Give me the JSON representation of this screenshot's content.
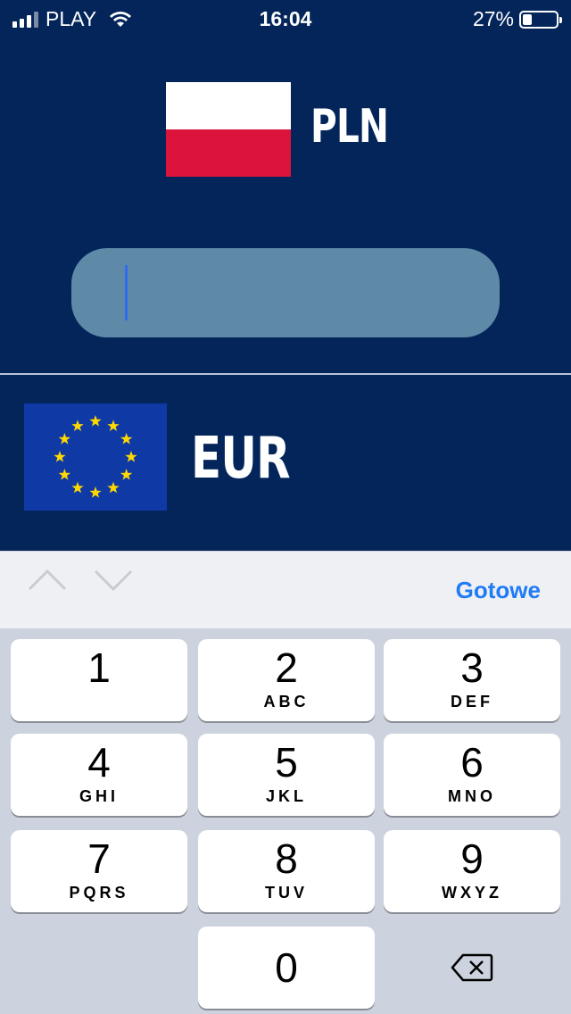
{
  "status": {
    "carrier": "PLAY",
    "time": "16:04",
    "battery": "27%",
    "battery_level": 0.27,
    "signal_bars": 3,
    "signal_max": 4
  },
  "converter": {
    "from": {
      "code": "PLN",
      "flag": "poland-flag"
    },
    "amount": {
      "value": "",
      "placeholder": ""
    },
    "to": {
      "code": "EUR",
      "flag": "eu-flag"
    }
  },
  "keyboard": {
    "toolbar": {
      "done": "Gotowe",
      "prev_icon": "chevron-up-icon",
      "next_icon": "chevron-down-icon"
    },
    "keys": [
      {
        "digit": "1",
        "letters": ""
      },
      {
        "digit": "2",
        "letters": "ABC"
      },
      {
        "digit": "3",
        "letters": "DEF"
      },
      {
        "digit": "4",
        "letters": "GHI"
      },
      {
        "digit": "5",
        "letters": "JKL"
      },
      {
        "digit": "6",
        "letters": "MNO"
      },
      {
        "digit": "7",
        "letters": "PQRS"
      },
      {
        "digit": "8",
        "letters": "TUV"
      },
      {
        "digit": "9",
        "letters": "WXYZ"
      },
      {
        "digit": "0",
        "letters": ""
      }
    ],
    "delete_icon": "backspace-icon"
  },
  "colors": {
    "background": "#03255a",
    "input": "#5e8aa8",
    "accent": "#1f7bf6",
    "pl_red": "#dc143c",
    "eu_blue": "#0f3aa6",
    "eu_star": "#ffd800"
  }
}
